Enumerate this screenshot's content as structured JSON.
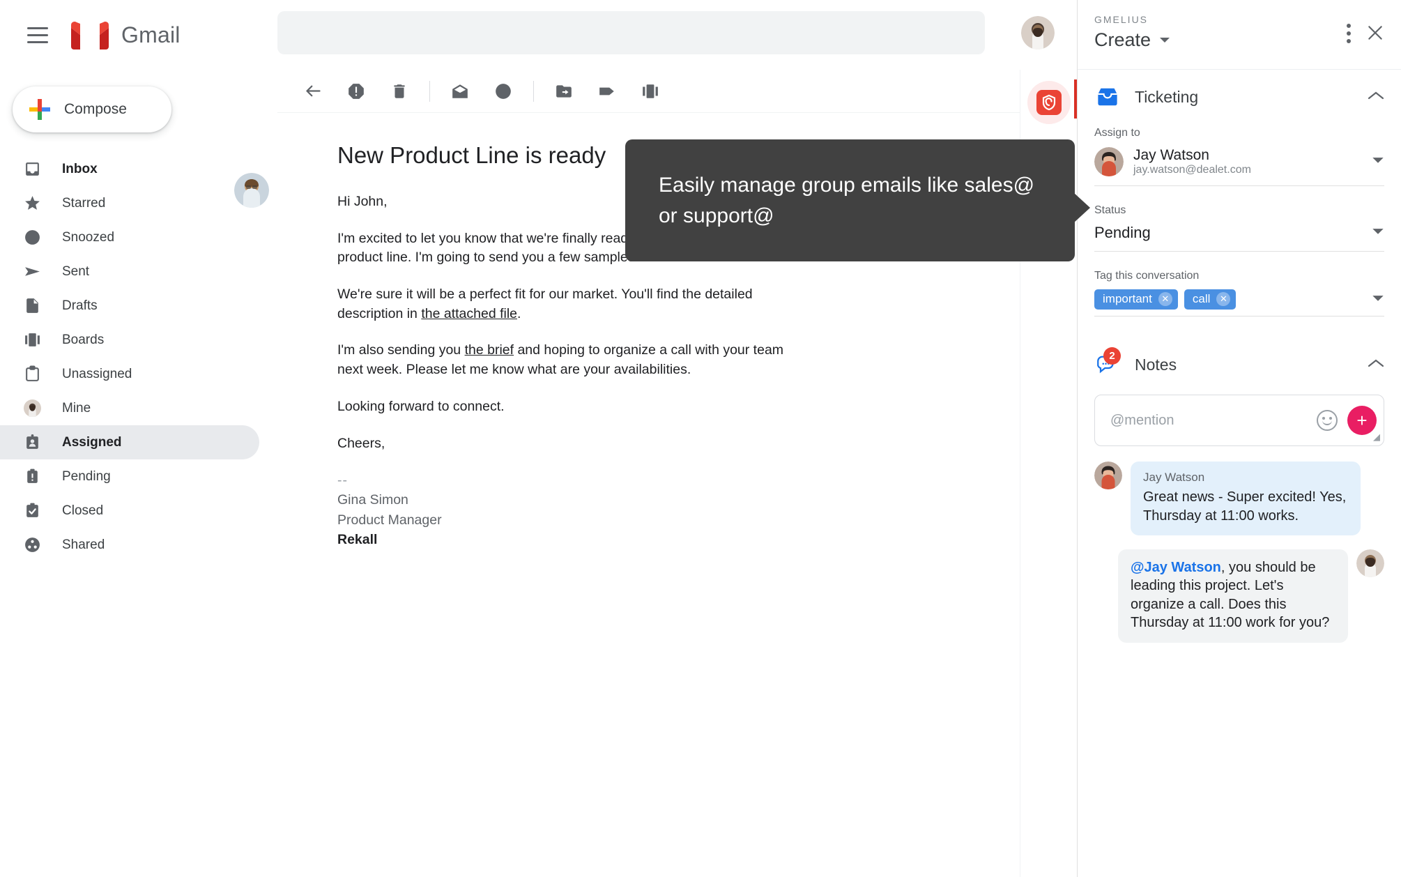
{
  "app": {
    "brand": "Gmail",
    "hamburger_icon": "menu-icon",
    "logo_icon": "gmail-logo-icon"
  },
  "search": {
    "value": "",
    "placeholder": ""
  },
  "account": {
    "avatar_icon": "user-avatar"
  },
  "compose": {
    "label": "Compose",
    "icon": "plus-multicolor-icon"
  },
  "sidebar": {
    "items": [
      {
        "label": "Inbox",
        "icon": "inbox-icon",
        "active": false,
        "bold": true
      },
      {
        "label": "Starred",
        "icon": "star-icon",
        "active": false,
        "bold": false
      },
      {
        "label": "Snoozed",
        "icon": "clock-icon",
        "active": false,
        "bold": false
      },
      {
        "label": "Sent",
        "icon": "send-icon",
        "active": false,
        "bold": false
      },
      {
        "label": "Drafts",
        "icon": "document-icon",
        "active": false,
        "bold": false
      },
      {
        "label": "Boards",
        "icon": "boards-icon",
        "active": false,
        "bold": false
      },
      {
        "label": "Unassigned",
        "icon": "clipboard-icon",
        "active": false,
        "bold": false
      },
      {
        "label": "Mine",
        "icon": "avatar-icon",
        "active": false,
        "bold": false
      },
      {
        "label": "Assigned",
        "icon": "assigned-icon",
        "active": true,
        "bold": true
      },
      {
        "label": "Pending",
        "icon": "pending-icon",
        "active": false,
        "bold": false
      },
      {
        "label": "Closed",
        "icon": "closed-check-icon",
        "active": false,
        "bold": false
      },
      {
        "label": "Shared",
        "icon": "shared-icon",
        "active": false,
        "bold": false
      }
    ]
  },
  "mail_toolbar": {
    "buttons": [
      {
        "name": "back-icon"
      },
      {
        "name": "report-spam-icon"
      },
      {
        "name": "delete-icon"
      },
      {
        "name": "mark-unread-icon"
      },
      {
        "name": "snooze-clock-icon"
      },
      {
        "name": "move-to-folder-icon"
      },
      {
        "name": "label-tag-icon"
      },
      {
        "name": "boards-icon"
      }
    ]
  },
  "email": {
    "subject": "New Product Line is ready",
    "greeting": "Hi John,",
    "paragraph1_a": "I'm excited to let you know that we're finally ready to launch our new product line. I'm going",
    "paragraph1_b": "to send you a few samples this week.",
    "paragraph2_pre": "We're sure it will be a perfect fit for our market. You'll find the detailed description in ",
    "paragraph2_link": "the attached file",
    "paragraph2_post": ".",
    "paragraph3_pre": "I'm also sending you ",
    "paragraph3_link": "the brief",
    "paragraph3_post": " and hoping to organize a call with your team next week. Please let me know what are your availabilities.",
    "paragraph4": "Looking forward to connect.",
    "closing": "Cheers,",
    "signature_dashes": "--",
    "signature_name": "Gina Simon",
    "signature_title": "Product Manager",
    "signature_company": "Rekall"
  },
  "tooltip": {
    "text": "Easily manage group emails like sales@ or support@"
  },
  "rail": {
    "gmelius_icon": "gmelius-g-icon",
    "tasks_icon": "google-tasks-icon",
    "add_icon": "plus-icon"
  },
  "panel": {
    "brand_label": "GMELIUS",
    "title": "Create",
    "title_caret_icon": "chevron-down-icon",
    "more_icon": "more-vertical-icon",
    "close_icon": "close-icon",
    "ticketing": {
      "icon": "ticket-inbox-icon",
      "title": "Ticketing",
      "collapse_icon": "chevron-up-icon",
      "assign_label": "Assign to",
      "assignee_name": "Jay Watson",
      "assignee_email": "jay.watson@dealet.com",
      "assignee_avatar": "jay-watson-avatar",
      "assignee_caret_icon": "chevron-down-icon",
      "status_label": "Status",
      "status_value": "Pending",
      "status_caret_icon": "chevron-down-icon",
      "tags_label": "Tag this conversation",
      "tags": [
        {
          "label": "important",
          "remove_icon": "chip-remove-icon"
        },
        {
          "label": "call",
          "remove_icon": "chip-remove-icon"
        }
      ],
      "tags_caret_icon": "chevron-down-icon"
    },
    "notes": {
      "icon": "notes-bubble-icon",
      "badge": "2",
      "title": "Notes",
      "collapse_icon": "chevron-up-icon",
      "input_placeholder": "@mention",
      "input_value": "",
      "emoji_icon": "smiley-icon",
      "add_icon": "add-note-icon",
      "messages": [
        {
          "direction": "incoming",
          "author": "Jay Watson",
          "avatar": "jay-watson-avatar",
          "text": "Great news - Super excited! Yes, Thursday at 11:00 works."
        },
        {
          "direction": "outgoing",
          "author": "",
          "avatar": "current-user-avatar",
          "mention": "@Jay Watson",
          "text": ", you should be leading this project. Let's organize a call. Does this Thursday at 11:00 work for you?"
        }
      ]
    }
  },
  "colors": {
    "gmail_red": "#ea4335",
    "accent_blue": "#1a73e8",
    "chip_blue": "#4a90e2",
    "pink": "#e91e63",
    "tooltip_bg": "#414141",
    "active_bg": "#e8eaed"
  }
}
